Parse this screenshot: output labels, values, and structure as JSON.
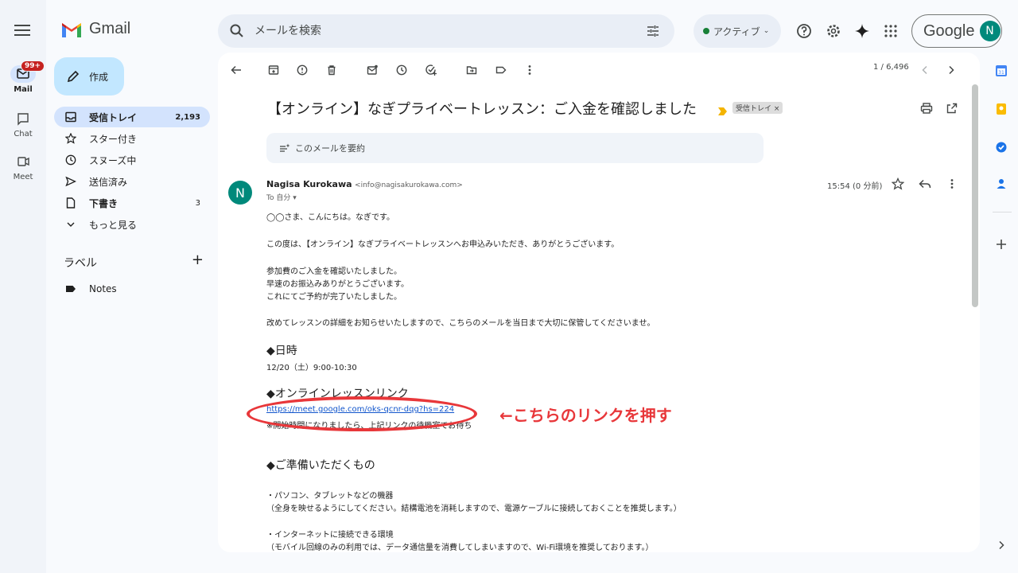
{
  "app": {
    "name": "Gmail"
  },
  "rail": {
    "badge": "99+",
    "items": [
      {
        "label": "Mail"
      },
      {
        "label": "Chat"
      },
      {
        "label": "Meet"
      }
    ]
  },
  "header": {
    "search_placeholder": "メールを検索",
    "status_label": "アクティブ",
    "account_brand": "Google",
    "avatar_letter": "N"
  },
  "sidebar": {
    "compose_label": "作成",
    "items": [
      {
        "label": "受信トレイ",
        "count": "2,193"
      },
      {
        "label": "スター付き",
        "count": ""
      },
      {
        "label": "スヌーズ中",
        "count": ""
      },
      {
        "label": "送信済み",
        "count": ""
      },
      {
        "label": "下書き",
        "count": "3"
      },
      {
        "label": "もっと見る",
        "count": ""
      }
    ],
    "labels_title": "ラベル",
    "labels_add": "+",
    "labels": [
      {
        "name": "Notes"
      }
    ]
  },
  "toolbar": {
    "pager": "1 / 6,496"
  },
  "email": {
    "subject": "【オンライン】なぎプライベートレッスン：ご入金を確認しました",
    "inbox_chip": "受信トレイ ×",
    "summary_label": "このメールを要約",
    "sender_name": "Nagisa Kurokawa",
    "sender_address": "<info@nagisakurokawa.com>",
    "to_label": "To 自分 ▾",
    "time": "15:54 (0 分前)",
    "avatar_letter": "N",
    "body": {
      "greeting": "◯◯さま、こんにちは。なぎです。",
      "p1": "この度は、【オンライン】なぎプライベートレッスンへお申込みいただき、ありがとうございます。",
      "p2_1": "参加費のご入金を確認いたしました。",
      "p2_2": "早速のお振込みありがとうございます。",
      "p2_3": "これにてご予約が完了いたしました。",
      "p3": "改めてレッスンの詳細をお知らせいたしますので、こちらのメールを当日まで大切に保管してくださいませ。",
      "h_date": "◆日時",
      "date": "12/20（土）9:00-10:30",
      "h_link": "◆オンラインレッスンリンク",
      "link": "https://meet.google.com/oks-qcnr-dqg?hs=224",
      "link_note": "※開始時間になりましたら、上記リンクの待機室でお待ち",
      "h_prep": "◆ご準備いただくもの",
      "prep1": "・パソコン、タブレットなどの機器",
      "prep1_note": "（全身を映せるようにしてください。結構電池を消耗しますので、電源ケーブルに接続しておくことを推奨します。）",
      "prep2": "・インターネットに接続できる環境",
      "prep2_note": "（モバイル回線のみの利用では、データ通信量を消費してしまいますので、Wi-Fi環境を推奨しております。）"
    }
  },
  "annotation": {
    "text": "←こちらのリンクを押す",
    "color": "#e8373a"
  },
  "colors": {
    "accent": "#0b57d0",
    "compose": "#c2e7ff",
    "active_nav": "#d3e3fd",
    "avatar": "#00897b"
  }
}
